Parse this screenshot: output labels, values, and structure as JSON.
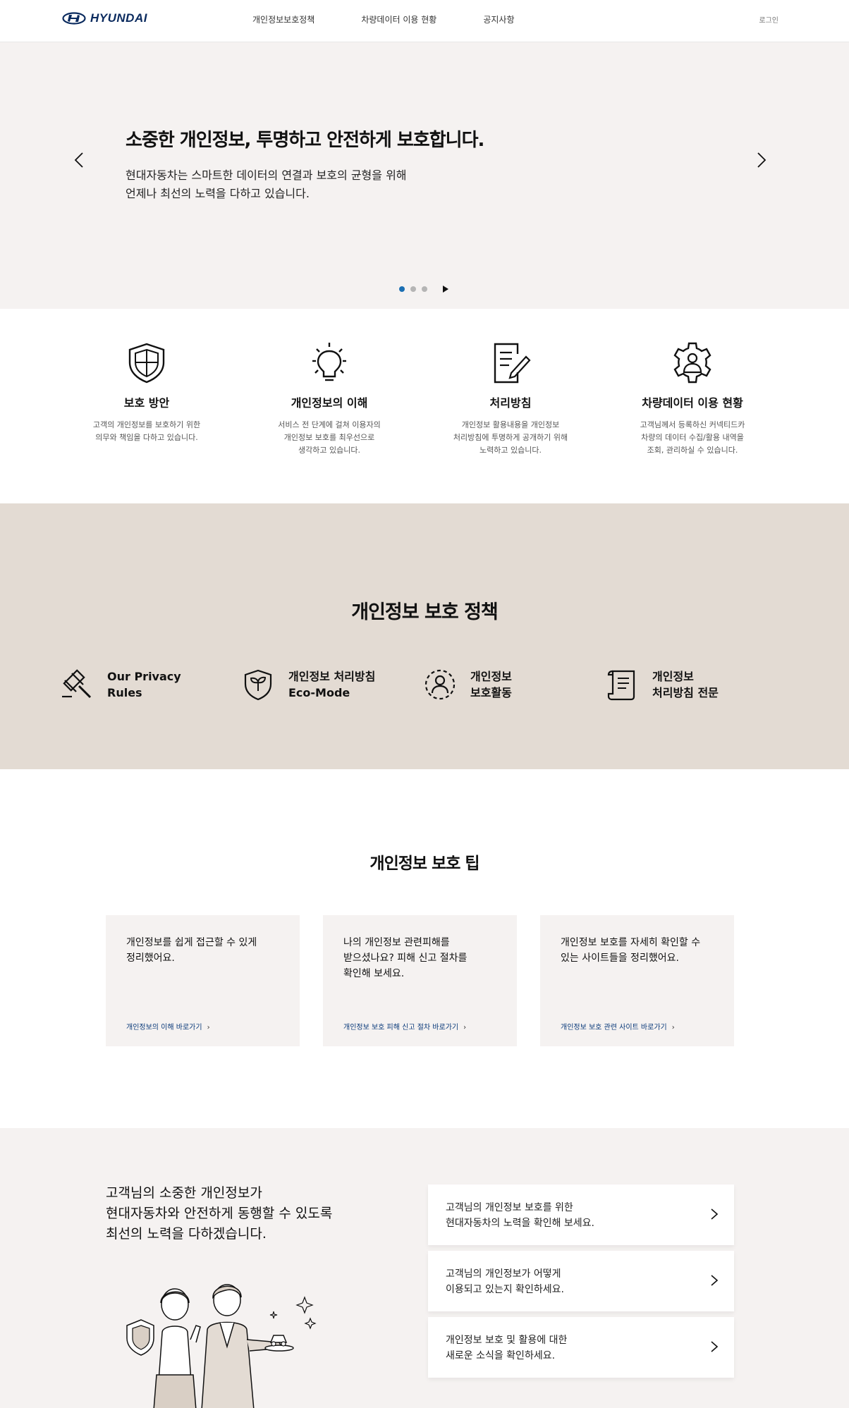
{
  "header": {
    "logo_text": "HYUNDAI",
    "nav": [
      "개인정보보호정책",
      "차량데이터 이용 현황",
      "공지사항"
    ],
    "login": "로그인"
  },
  "hero": {
    "title": "소중한 개인정보, 투명하고 안전하게 보호합니다.",
    "description": "현대자동차는 스마트한 데이터의 연결과 보호의 균형을 위해\n언제나 최선의 노력을 다하고 있습니다."
  },
  "features": [
    {
      "title": "보호 방안",
      "desc": "고객의 개인정보를 보호하기 위한\n의무와 책임을 다하고 있습니다.",
      "icon": "shield-icon"
    },
    {
      "title": "개인정보의 이해",
      "desc": "서비스 전 단계에 걸쳐 이용자의\n개인정보 보호를 최우선으로\n생각하고 있습니다.",
      "icon": "lightbulb-icon"
    },
    {
      "title": "처리방침",
      "desc": "개인정보 활용내용을 개인정보\n처리방침에 투명하게 공개하기 위해\n노력하고 있습니다.",
      "icon": "document-pen-icon"
    },
    {
      "title": "차량데이터 이용 현황",
      "desc": "고객님께서 등록하신 커넥티드카\n차량의 데이터 수집/활용 내역을\n조회, 관리하실 수 있습니다.",
      "icon": "gear-user-icon"
    }
  ],
  "policy": {
    "title": "개인정보 보호 정책",
    "items": [
      {
        "label": "Our Privacy\nRules",
        "icon": "gavel-icon"
      },
      {
        "label": "개인정보 처리방침\nEco-Mode",
        "icon": "leaf-shield-icon"
      },
      {
        "label": "개인정보\n보호활동",
        "icon": "user-dashed-icon"
      },
      {
        "label": "개인정보\n처리방침 전문",
        "icon": "scroll-icon"
      }
    ]
  },
  "tips": {
    "title": "개인정보 보호 팁",
    "items": [
      {
        "text": "개인정보를 쉽게 접근할 수 있게\n정리했어요.",
        "link": "개인정보의 이해 바로가기"
      },
      {
        "text": "나의 개인정보 관련피해를\n받으셨나요? 피해 신고 절차를\n확인해 보세요.",
        "link": "개인정보 보호 피해 신고 절차 바로가기"
      },
      {
        "text": "개인정보 보호를 자세히 확인할 수\n있는 사이트들을 정리했어요.",
        "link": "개인정보 보호 관련 사이트 바로가기"
      }
    ]
  },
  "bottom": {
    "title": "고객님의 소중한 개인정보가\n현대자동차와 안전하게 동행할 수 있도록\n최선의 노력을 다하겠습니다.",
    "cards": [
      "고객님의 개인정보 보호를 위한\n현대자동차의 노력을 확인해 보세요.",
      "고객님의 개인정보가 어떻게\n이용되고 있는지 확인하세요.",
      "개인정보 보호 및 활용에 대한\n새로운 소식을 확인하세요."
    ]
  },
  "colors": {
    "brand": "#0a2a5e",
    "hero_bg": "#f5f2f1",
    "policy_bg": "#e3dbd3",
    "dot_active": "#1b6fb3"
  }
}
